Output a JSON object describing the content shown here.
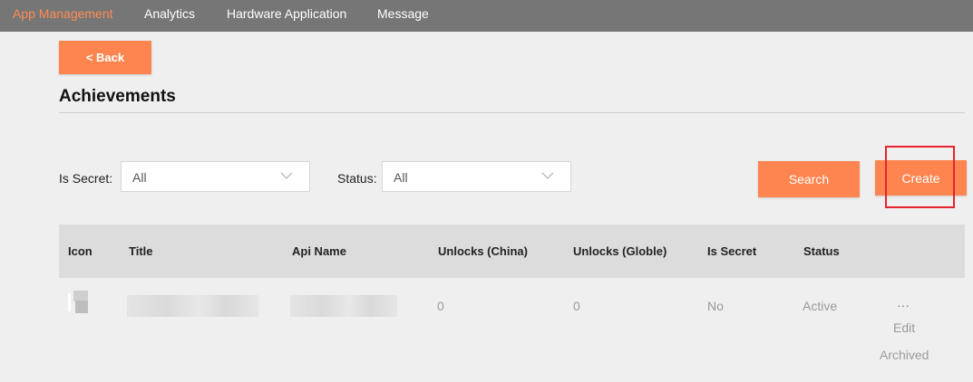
{
  "nav": {
    "items": [
      {
        "label": "App Management",
        "active": true
      },
      {
        "label": "Analytics",
        "active": false
      },
      {
        "label": "Hardware Application",
        "active": false
      },
      {
        "label": "Message",
        "active": false
      }
    ]
  },
  "back_label": "< Back",
  "page_title": "Achievements",
  "filters": {
    "is_secret": {
      "label": "Is Secret:",
      "value": "All"
    },
    "status": {
      "label": "Status:",
      "value": "All"
    }
  },
  "actions": {
    "search_label": "Search",
    "create_label": "Create"
  },
  "table": {
    "columns": [
      "Icon",
      "Title",
      "Api Name",
      "Unlocks (China)",
      "Unlocks (Globle)",
      "Is Secret",
      "Status"
    ],
    "rows": [
      {
        "unlocks_china": "0",
        "unlocks_globle": "0",
        "is_secret": "No",
        "status": "Active",
        "more": "···",
        "edit_label": "Edit",
        "archived_label": "Archived"
      }
    ]
  },
  "colors": {
    "accent": "#ff8550",
    "nav_bg": "#767676",
    "nav_active": "#ff8c55",
    "highlight": "#e8232b",
    "background": "#efefef"
  },
  "icons": [
    "chevron-down-icon",
    "more-icon"
  ]
}
